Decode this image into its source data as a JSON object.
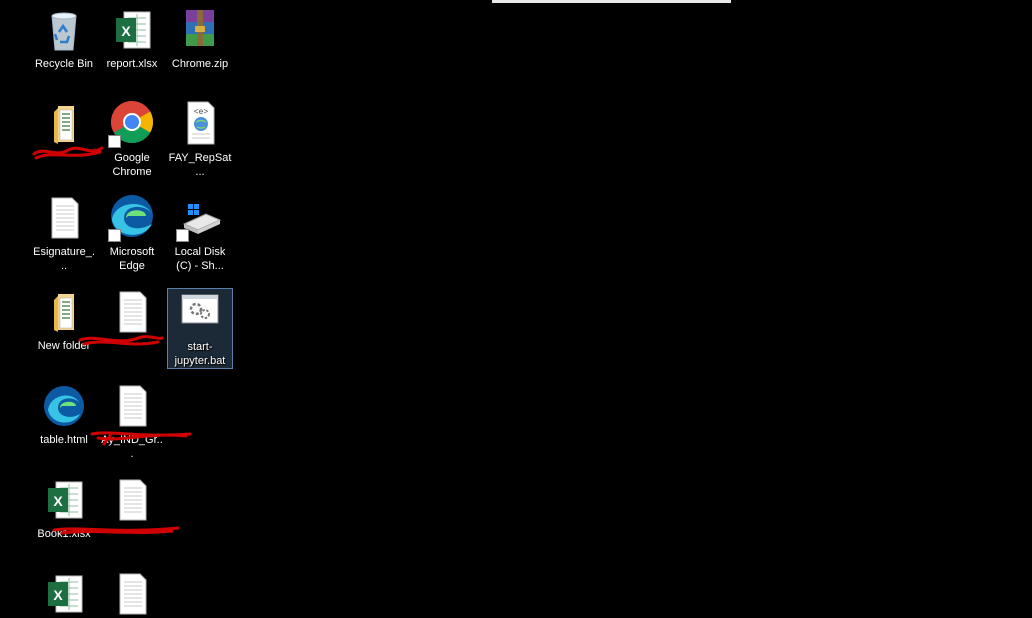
{
  "desktop": {
    "icons": [
      {
        "label": "Recycle Bin",
        "icon": "recycle-bin-icon"
      },
      {
        "label": "report.xlsx",
        "icon": "excel-icon"
      },
      {
        "label": "Chrome.zip",
        "icon": "winrar-archive-icon"
      },
      {
        "label": "Google Chrome",
        "icon": "chrome-icon"
      },
      {
        "label": "FAY_RepSat...",
        "icon": "html-document-icon"
      },
      {
        "label": "Esignature_...",
        "icon": "text-document-icon"
      },
      {
        "label": "Microsoft Edge",
        "icon": "edge-icon"
      },
      {
        "label": "Local Disk (C) - Sh...",
        "icon": "local-disk-icon"
      },
      {
        "label": "New folder",
        "icon": "folder-icon"
      },
      {
        "label": "start-jupyter.bat",
        "icon": "batch-file-icon"
      },
      {
        "label": "table.html",
        "icon": "edge-html-icon"
      },
      {
        "label": "Ay_IND_Gr...",
        "icon": "text-document-icon"
      },
      {
        "label": "Book1.xlsx",
        "icon": "excel-icon"
      }
    ],
    "colors": {
      "background": "#000000",
      "selection": "#5a7fa8",
      "redact": "#d10000",
      "excel_green": "#1d6f42"
    }
  }
}
